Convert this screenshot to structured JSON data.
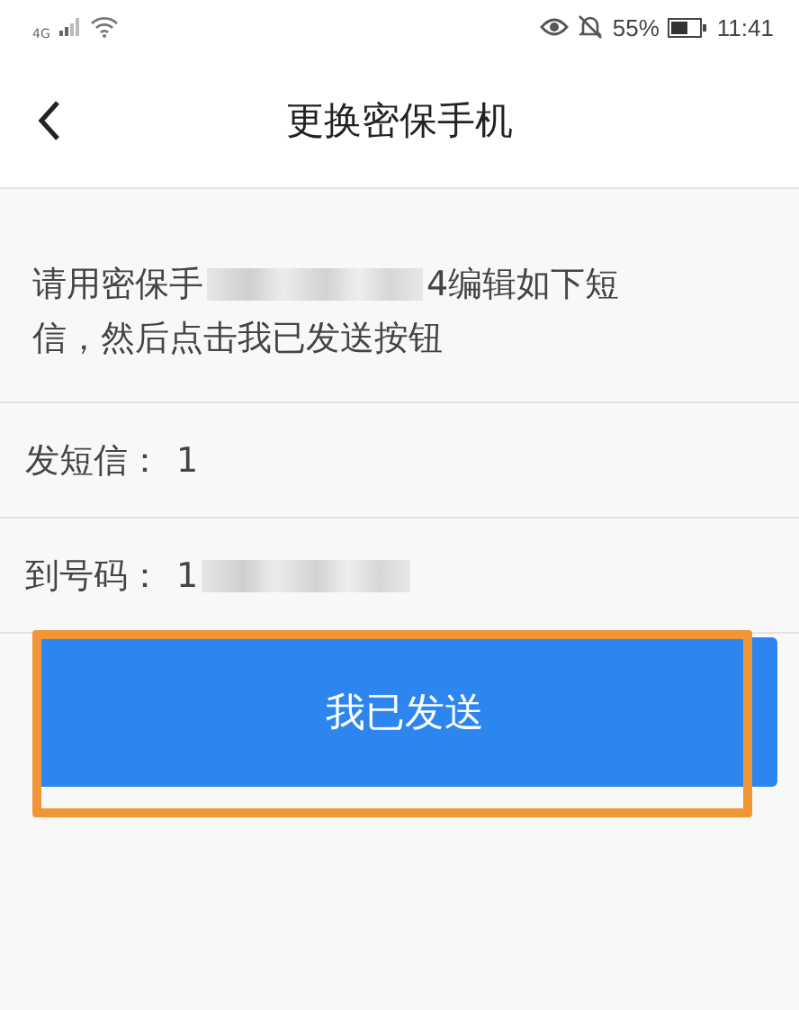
{
  "status_bar": {
    "network": "4G",
    "battery_percent": "55%",
    "time": "11:41"
  },
  "header": {
    "title": "更换密保手机"
  },
  "instruction": {
    "before": "请用密保手",
    "after": "4编辑如下短",
    "line2": "信，然后点击我已发送按钮"
  },
  "rows": [
    {
      "label": "发短信：",
      "value": "1",
      "redacted": false
    },
    {
      "label": "到号码：",
      "value": "1",
      "redacted": true
    }
  ],
  "button": {
    "label": "我已发送",
    "highlighted": true
  }
}
